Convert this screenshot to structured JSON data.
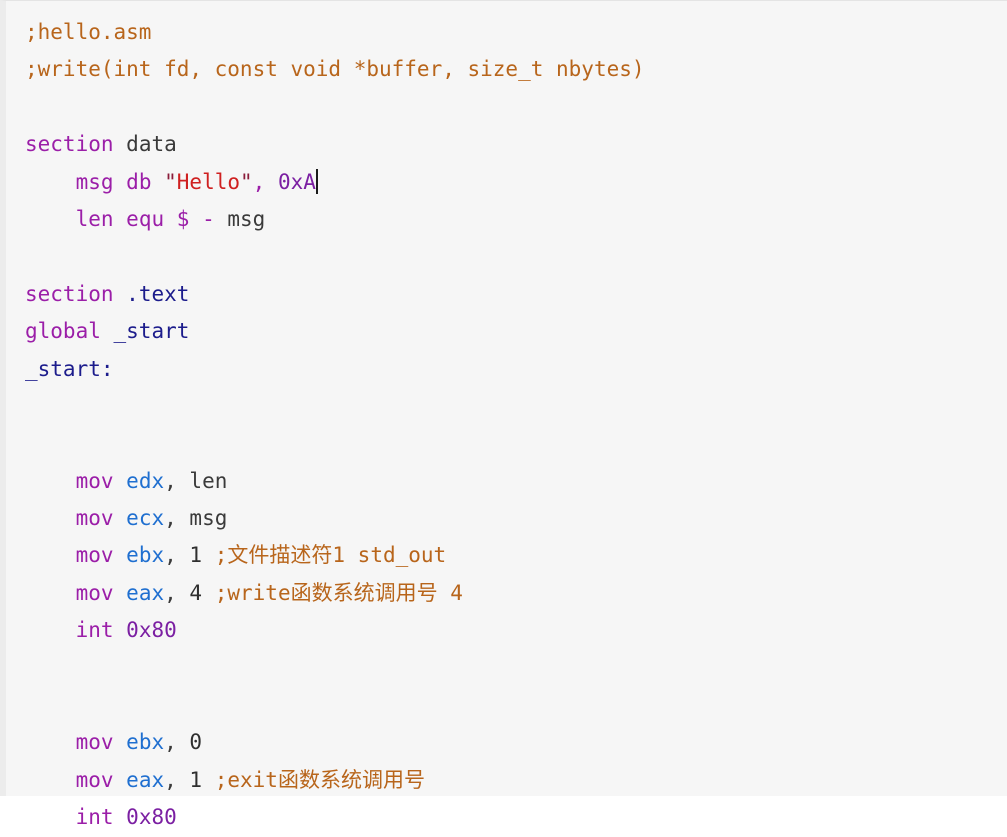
{
  "editor": {
    "name": "assembly-code-viewer",
    "language": "nasm-assembly",
    "caret_after": "0xA",
    "background_color": "#f6f6f6",
    "gutter_color": "#ececec",
    "colors": {
      "comment": "#b8651b",
      "keyword": "#9b1ea8",
      "register": "#1f6fd0",
      "identifier": "#3a3a3a",
      "label": "#1c1c8c",
      "number": "#7b1fa2",
      "string": "#cf2020",
      "quote": "#8a1c3a",
      "caret": "#1a1a1a"
    }
  },
  "code": {
    "line_01": ";hello.asm",
    "line_02": ";write(int fd, const void *buffer, size_t nbytes)",
    "line_03": "",
    "line_04_kw": "section",
    "line_04_arg": "data",
    "line_05_name": "msg",
    "line_05_dir": "db",
    "line_05_quote_open": "\"",
    "line_05_str": "Hello",
    "line_05_quote_close": "\"",
    "line_05_comma": ",",
    "line_05_num": "0xA",
    "line_06_name": "len",
    "line_06_dir": "equ",
    "line_06_dollar": "$",
    "line_06_minus": "-",
    "line_06_ref": "msg",
    "line_07": "",
    "line_08_kw": "section",
    "line_08_arg": ".text",
    "line_09_kw": "global",
    "line_09_arg": "_start",
    "line_10_label": "_start:",
    "line_11": "",
    "line_12": "",
    "line_13_op": "mov",
    "line_13_reg": "edx",
    "line_13_comma": ",",
    "line_13_arg": "len",
    "line_14_op": "mov",
    "line_14_reg": "ecx",
    "line_14_comma": ",",
    "line_14_arg": "msg",
    "line_15_op": "mov",
    "line_15_reg": "ebx",
    "line_15_comma": ",",
    "line_15_val": "1",
    "line_15_cmt_pre": ";",
    "line_15_cmt_cjk": "文件描述符",
    "line_15_cmt_post": "1 std_out",
    "line_16_op": "mov",
    "line_16_reg": "eax",
    "line_16_comma": ",",
    "line_16_val": "4",
    "line_16_cmt_pre": ";write",
    "line_16_cmt_cjk": "函数系统调用号",
    "line_16_cmt_post": " 4",
    "line_17_op": "int",
    "line_17_num": "0x80",
    "line_18": "",
    "line_19": "",
    "line_20_op": "mov",
    "line_20_reg": "ebx",
    "line_20_comma": ",",
    "line_20_val": "0",
    "line_21_op": "mov",
    "line_21_reg": "eax",
    "line_21_comma": ",",
    "line_21_val": "1",
    "line_21_cmt_pre": ";exit",
    "line_21_cmt_cjk": "函数系统调用号",
    "line_22_op": "int",
    "line_22_num": "0x80"
  }
}
